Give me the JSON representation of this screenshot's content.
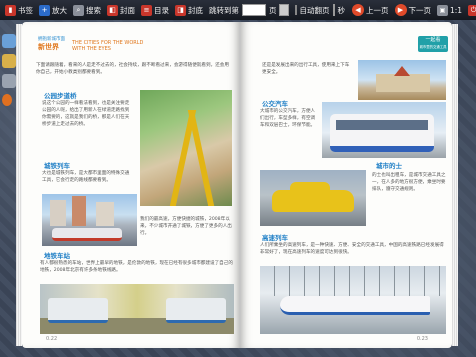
{
  "toolbar": {
    "bookmark": "书签",
    "zoom_in": "放大",
    "search": "搜索",
    "cover": "封面",
    "toc": "目录",
    "back_cover": "封底",
    "jump_label": "跳转到第",
    "page_unit": "页",
    "auto_flip": "自动翻页",
    "seconds": "秒",
    "prev": "上一页",
    "next": "下一页",
    "ratio": "1:1",
    "exit": "退出"
  },
  "left_page": {
    "header_small": "拥抱新城市面",
    "header_big": "新世界",
    "header_en": "THE CITIES FOR THE WORLD WITH THE EYES",
    "intro": "下面请跟随着，看来的人是走不过去的，社会持续，跟不断看过来，会游得随便就看到，还会用你自己，开始小教类别都要看到。",
    "s1_title": "公园步道桥",
    "s1_body": "说这个公园的一样看法看到，也是关注要走公园的人呢，给出了用新人在绿道走路找到你需要的，这就是我们的桥，那是人们在天桥步道上走过去的桥。",
    "s2_title": "城铁列车",
    "s2_body": "大也是城铁列车，是大都市里面的特殊交通工具，它会行走的路线都要看到。",
    "s2_caption": "我们的最高速，方便快捷的城铁，2008年以来，不少城市开通了城铁，方便了更多的人出行。",
    "s3_title": "地铁车站",
    "s3_body": "有人都很熟悉的车站，世界上最早的地铁，是伦敦的地铁，现在已经有很多城市都建设了自己的地铁，2008年北京有许多条地铁线路。",
    "page_number": "0.22"
  },
  "right_page": {
    "top_body": "还是是发展出来的出行工具，使用来上下车更安全。",
    "r1_title": "公交汽车",
    "r1_body": "大城市的公交汽车，方便人们出行，车型多样，有空调车和双层巴士，环保节能。",
    "r2_title": "城市的士",
    "r2_body": "的士也叫出租车，是城市交通工具之一，在人多的地方很方便，乘坐时要排队，遵守交通规则。",
    "r3_title": "高速列车",
    "r3_body": "人们所乘坐的高速列车，是一种快速、方便、安全的交通工具，中国的高速铁路已经发展得非常好了，现在高速列车的速度可达到很快。",
    "badge": "一起看",
    "badge_sub": "城市里的交通工具",
    "page_number": "0.23"
  }
}
